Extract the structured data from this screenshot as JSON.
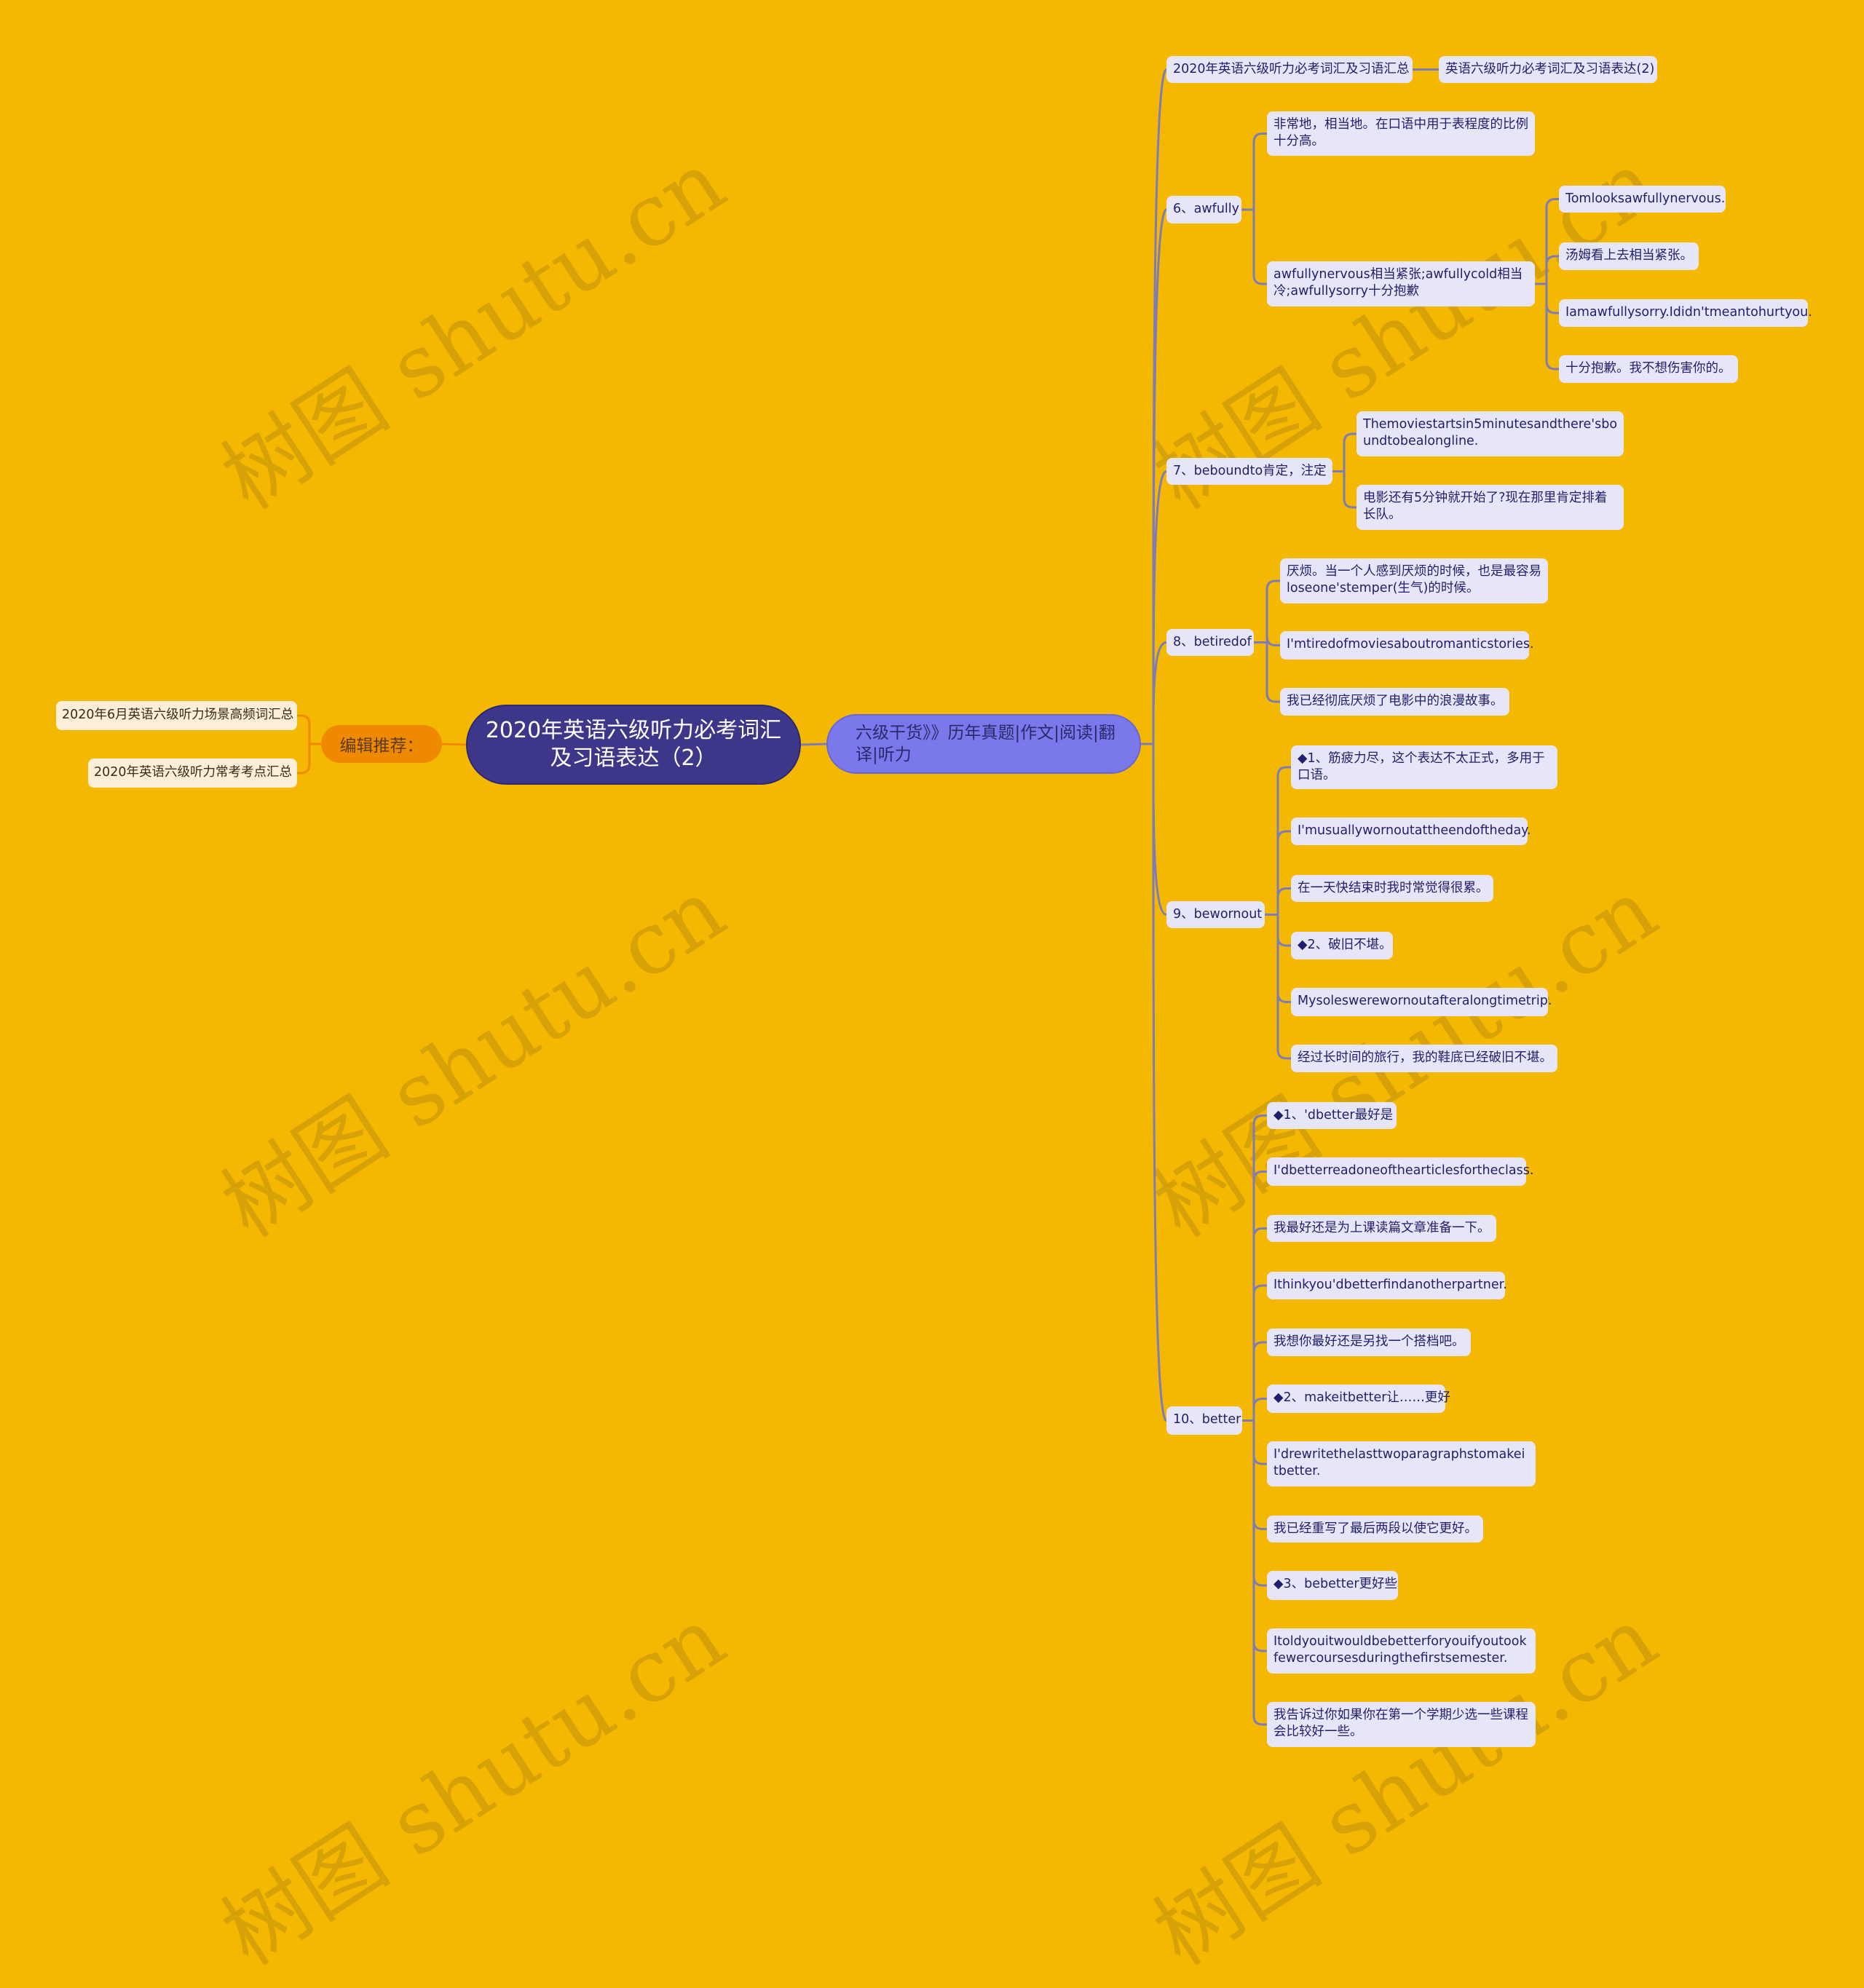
{
  "watermark": "树图 shutu.cn",
  "colors": {
    "background": "#f5b800",
    "root_fill": "#3d3789",
    "branch_fill": "#7b78eb",
    "editor_fill": "#ef8a00",
    "leaf_fill": "#e6e6f8",
    "left_leaf_fill": "#fdeed8",
    "right_link": "#7e7cb6",
    "left_link": "#ef8a00"
  },
  "root": {
    "title": "2020年英语六级听力必考词汇及习语表达（2）"
  },
  "left": {
    "label": "编辑推荐：",
    "items": [
      "2020年6月英语六级听力场景高频词汇总",
      "2020年英语六级听力常考考点汇总"
    ]
  },
  "branch": {
    "label": "六级干货》》历年真题|作文|阅读|翻译|听力",
    "children": [
      {
        "label": "2020年英语六级听力必考词汇及习语汇总",
        "children": [
          {
            "label": "英语六级听力必考词汇及习语表达(2)"
          }
        ]
      },
      {
        "label": "6、awfully",
        "children": [
          {
            "label": "非常地，相当地。在口语中用于表程度的比例十分高。"
          },
          {
            "label": "awfullynervous相当紧张;awfullycold相当冷;awfullysorry十分抱歉",
            "children": [
              {
                "label": "Tomlooksawfullynervous."
              },
              {
                "label": "汤姆看上去相当紧张。"
              },
              {
                "label": "Iamawfullysorry.Ididn'tmeantohurtyou."
              },
              {
                "label": "十分抱歉。我不想伤害你的。"
              }
            ]
          }
        ]
      },
      {
        "label": "7、beboundto肯定，注定",
        "children": [
          {
            "label": "Themoviestartsin5minutesandthere'sboundtobealongline."
          },
          {
            "label": "电影还有5分钟就开始了?现在那里肯定排着长队。"
          }
        ]
      },
      {
        "label": "8、betiredof",
        "children": [
          {
            "label": "厌烦。当一个人感到厌烦的时候，也是最容易loseone'stemper(生气)的时候。"
          },
          {
            "label": "I'mtiredofmoviesaboutromanticstories."
          },
          {
            "label": "我已经彻底厌烦了电影中的浪漫故事。"
          }
        ]
      },
      {
        "label": "9、bewornout",
        "children": [
          {
            "label": "◆1、筋疲力尽，这个表达不太正式，多用于口语。"
          },
          {
            "label": "I'musuallywornoutattheendoftheday."
          },
          {
            "label": "在一天快结束时我时常觉得很累。"
          },
          {
            "label": "◆2、破旧不堪。"
          },
          {
            "label": "Mysoleswerewornoutafteralongtimetrip."
          },
          {
            "label": "经过长时间的旅行，我的鞋底已经破旧不堪。"
          }
        ]
      },
      {
        "label": "10、better",
        "children": [
          {
            "label": "◆1、'dbetter最好是"
          },
          {
            "label": "I'dbetterreadoneofthearticlesfortheclass."
          },
          {
            "label": "我最好还是为上课读篇文章准备一下。"
          },
          {
            "label": "Ithinkyou'dbetterfindanotherpartner."
          },
          {
            "label": "我想你最好还是另找一个搭档吧。"
          },
          {
            "label": "◆2、makeitbetter让……更好"
          },
          {
            "label": "I'drewritethelasttwoparagraphstomakeitbetter."
          },
          {
            "label": "我已经重写了最后两段以使它更好。"
          },
          {
            "label": "◆3、bebetter更好些"
          },
          {
            "label": "Itoldyouitwouldbebetterforyouifyoutookfewercoursesduringthefirstsemester."
          },
          {
            "label": "我告诉过你如果你在第一个学期少选一些课程会比较好一些。"
          }
        ]
      }
    ]
  }
}
